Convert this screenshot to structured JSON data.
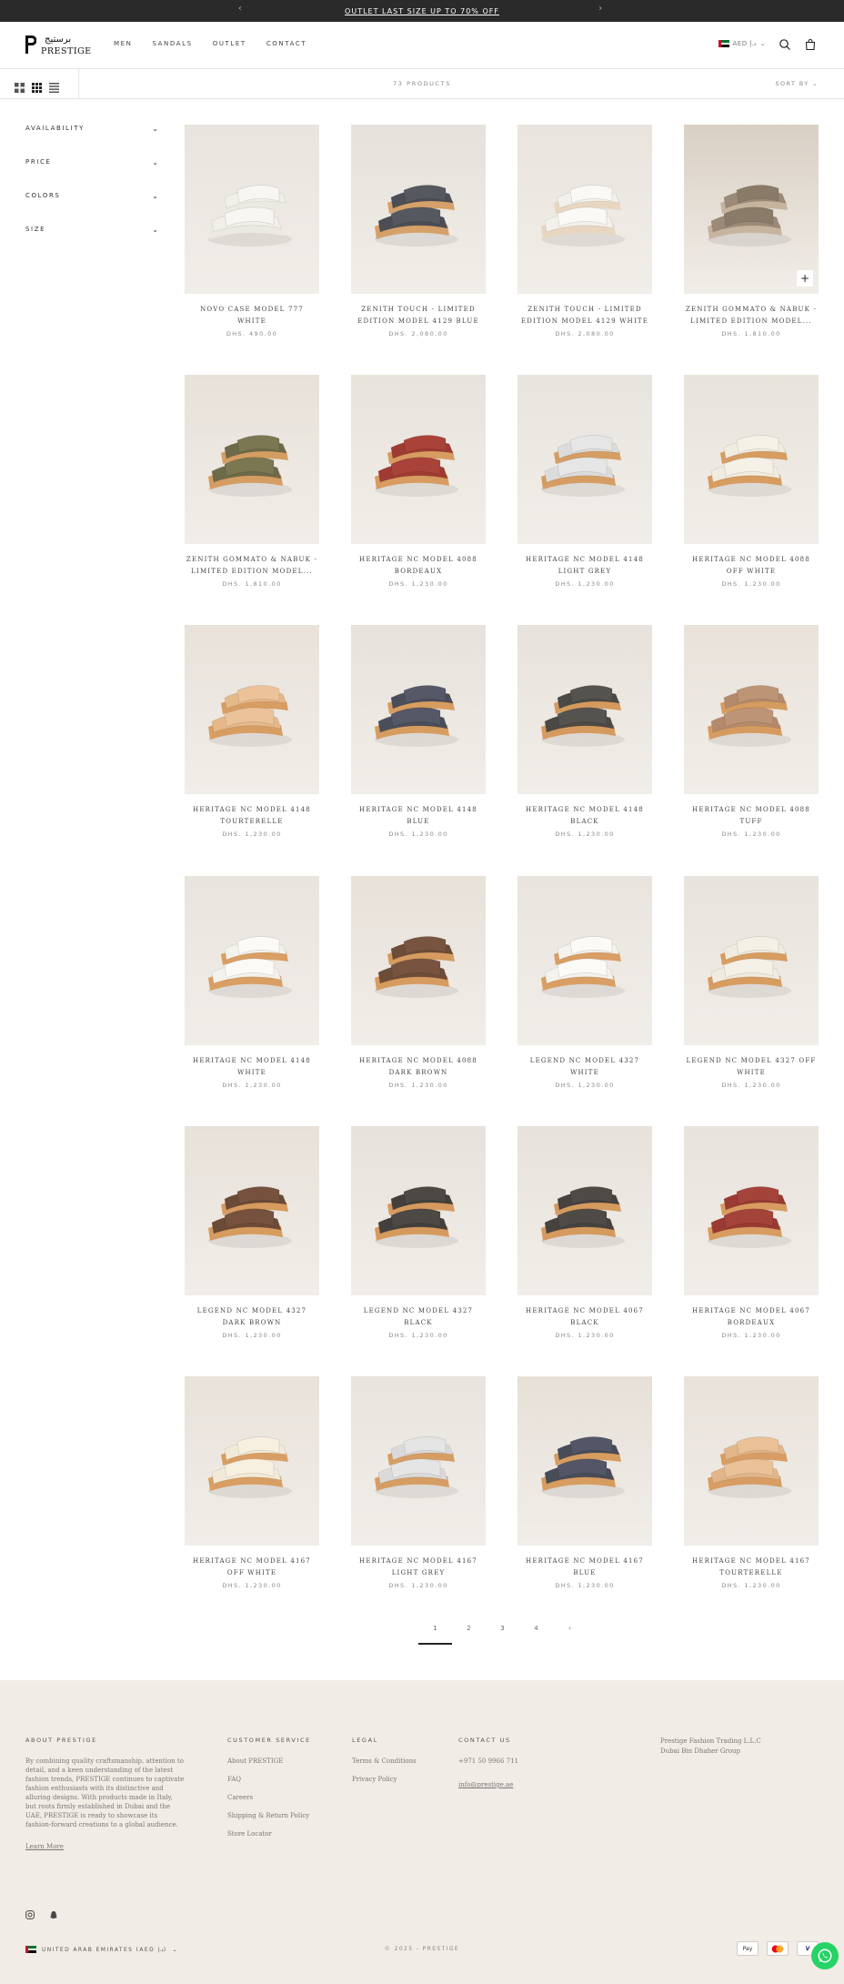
{
  "announcement": {
    "text": "OUTLET LAST SIZE UP TO 70% OFF"
  },
  "header": {
    "logo_arabic": "برستيج",
    "logo_latin": "PRESTIGE",
    "nav": [
      "MEN",
      "SANDALS",
      "OUTLET",
      "CONTACT"
    ],
    "currency": "AED د.إ"
  },
  "toolbar": {
    "product_count": "73 PRODUCTS",
    "sort_label": "SORT BY"
  },
  "filters": [
    "AVAILABILITY",
    "PRICE",
    "COLORS",
    "SIZE"
  ],
  "products": [
    {
      "title": "NOVO CASE MODEL 777 WHITE",
      "price": "DHS. 490.00",
      "color": "#f1efe9",
      "strap": "#f7f6f2",
      "sole": "#ece9e2",
      "bg": "#e9e4de"
    },
    {
      "title": "ZENITH TOUCH - LIMITED EDITION MODEL 4129 BLUE",
      "price": "DHS. 2,080.00",
      "color": "#4b4e55",
      "strap": "#55585f",
      "sole": "#d6a06a",
      "bg": "#e6e1da"
    },
    {
      "title": "ZENITH TOUCH - LIMITED EDITION MODEL 4129 WHITE",
      "price": "DHS. 2,080.00",
      "color": "#f3f1ec",
      "strap": "#faf9f5",
      "sole": "#e8d6c0",
      "bg": "#e9e4dd"
    },
    {
      "title": "ZENITH GOMMATO & NABUK - LIMITED EDITION MODEL...",
      "price": "DHS. 1,810.00",
      "color": "#9b8a77",
      "strap": "#8a7a68",
      "sole": "#c7b49e",
      "bg": "#d9d0c4"
    },
    {
      "title": "ZENITH GOMMATO & NABUK - LIMITED EDITION MODEL...",
      "price": "DHS. 1,810.00",
      "color": "#6c6a48",
      "strap": "#7a7752",
      "sole": "#d49d62",
      "bg": "#e7e1d9"
    },
    {
      "title": "HERITAGE NC MODEL 4088 BORDEAUX",
      "price": "DHS. 1,230.00",
      "color": "#9e3b33",
      "strap": "#a9433a",
      "sole": "#d89b60",
      "bg": "#e8e3dc"
    },
    {
      "title": "HERITAGE NC MODEL 4148 LIGHT GREY",
      "price": "DHS. 1,230.00",
      "color": "#dcdcdc",
      "strap": "#e6e6e6",
      "sole": "#d69d63",
      "bg": "#e8e4de"
    },
    {
      "title": "HERITAGE NC MODEL 4088 OFF WHITE",
      "price": "DHS. 1,230.00",
      "color": "#f1ece0",
      "strap": "#f5f1e7",
      "sole": "#d69c60",
      "bg": "#e8e3dc"
    },
    {
      "title": "HERITAGE NC MODEL 4148 TOURTERELLE",
      "price": "DHS. 1,230.00",
      "color": "#e5b88a",
      "strap": "#ecc298",
      "sole": "#d79d62",
      "bg": "#e8e2da"
    },
    {
      "title": "HERITAGE NC MODEL 4148 BLUE",
      "price": "DHS. 1,230.00",
      "color": "#4a4d5a",
      "strap": "#545867",
      "sole": "#d79c5f",
      "bg": "#e7e2db"
    },
    {
      "title": "HERITAGE NC MODEL 4148 BLACK",
      "price": "DHS. 1,230.00",
      "color": "#4b4946",
      "strap": "#55534f",
      "sole": "#d59a5d",
      "bg": "#e7e2db"
    },
    {
      "title": "HERITAGE NC MODEL 4088 TUFF",
      "price": "DHS. 1,230.00",
      "color": "#b48a6c",
      "strap": "#bd9475",
      "sole": "#d69b5f",
      "bg": "#e8e2da"
    },
    {
      "title": "HERITAGE NC MODEL 4148 WHITE",
      "price": "DHS. 1,230.00",
      "color": "#f4f2ec",
      "strap": "#fbfaf6",
      "sole": "#d99e63",
      "bg": "#e9e4de"
    },
    {
      "title": "HERITAGE NC MODEL 4088 DARK BROWN",
      "price": "DHS. 1,230.00",
      "color": "#6d4c38",
      "strap": "#785440",
      "sole": "#d69b5f",
      "bg": "#e7e1d9"
    },
    {
      "title": "LEGEND NC MODEL 4327 WHITE",
      "price": "DHS. 1,230.00",
      "color": "#f4f2ec",
      "strap": "#fbfaf6",
      "sole": "#d99e63",
      "bg": "#e9e4de"
    },
    {
      "title": "LEGEND NC MODEL 4327 OFF WHITE",
      "price": "DHS. 1,230.00",
      "color": "#f0ebdf",
      "strap": "#f5f0e5",
      "sole": "#d79c60",
      "bg": "#e8e3dc"
    },
    {
      "title": "LEGEND NC MODEL 4327 DARK BROWN",
      "price": "DHS. 1,230.00",
      "color": "#6b4a36",
      "strap": "#76523e",
      "sole": "#d69b5f",
      "bg": "#e7e1d9"
    },
    {
      "title": "LEGEND NC MODEL 4327 BLACK",
      "price": "DHS. 1,230.00",
      "color": "#423f3c",
      "strap": "#4c4945",
      "sole": "#d59a5d",
      "bg": "#e7e2db"
    },
    {
      "title": "HERITAGE NC MODEL 4067 BLACK",
      "price": "DHS. 1,230.00",
      "color": "#45423f",
      "strap": "#4e4b47",
      "sole": "#d59a5d",
      "bg": "#e7e2db"
    },
    {
      "title": "HERITAGE NC MODEL 4067 BORDEAUX",
      "price": "DHS. 1,230.00",
      "color": "#9a3a32",
      "strap": "#a4433a",
      "sole": "#d89b60",
      "bg": "#e8e3dc"
    },
    {
      "title": "HERITAGE NC MODEL 4167 OFF WHITE",
      "price": "DHS. 1,230.00",
      "color": "#f2ead8",
      "strap": "#f7f0e0",
      "sole": "#d99e63",
      "bg": "#e8e2da"
    },
    {
      "title": "HERITAGE NC MODEL 4167 LIGHT GREY",
      "price": "DHS. 1,230.00",
      "color": "#dadada",
      "strap": "#e5e5e5",
      "sole": "#d69d63",
      "bg": "#e8e4de"
    },
    {
      "title": "HERITAGE NC MODEL 4167 BLUE",
      "price": "DHS. 1,230.00",
      "color": "#484c59",
      "strap": "#525666",
      "sole": "#d79c5f",
      "bg": "#e6e0d8"
    },
    {
      "title": "HERITAGE NC MODEL 4167 TOURTERELLE",
      "price": "DHS. 1,230.00",
      "color": "#e2b58a",
      "strap": "#eac197",
      "sole": "#d79d62",
      "bg": "#e8e2da"
    }
  ],
  "pagination": [
    "1",
    "2",
    "3",
    "4",
    "›"
  ],
  "footer": {
    "about_title": "ABOUT PRESTIGE",
    "about_text": "By combining quality craftsmanship, attention to detail, and a keen understanding of the latest fashion trends, PRESTIGE continues to captivate fashion enthusiasts with its distinctive and alluring designs. With products made in Italy, but roots firmly established in Dubai and the UAE, PRESTIGE is ready to showcase its fashion-forward creations to a global audience.",
    "learn_more": "Learn More",
    "customer_title": "CUSTOMER SERVICE",
    "customer_links": [
      "About PRESTIGE",
      "FAQ",
      "Careers",
      "Shipping & Return Policy",
      "Store Locator"
    ],
    "legal_title": "LEGAL",
    "legal_links": [
      "Terms & Conditions",
      "Privacy Policy"
    ],
    "contact_title": "CONTACT US",
    "phone": "+971 50 9966 711",
    "email": "info@prestige.ae",
    "address_1": "Prestige Fashion Trading L.L.C",
    "address_2": "Dubai Bin Dhaher Group",
    "country": "UNITED ARAB EMIRATES (AED د.إ)",
    "copyright": "© 2025 - PRESTIGE",
    "payments": [
      "Apple Pay",
      "Mastercard",
      "Visa"
    ]
  }
}
